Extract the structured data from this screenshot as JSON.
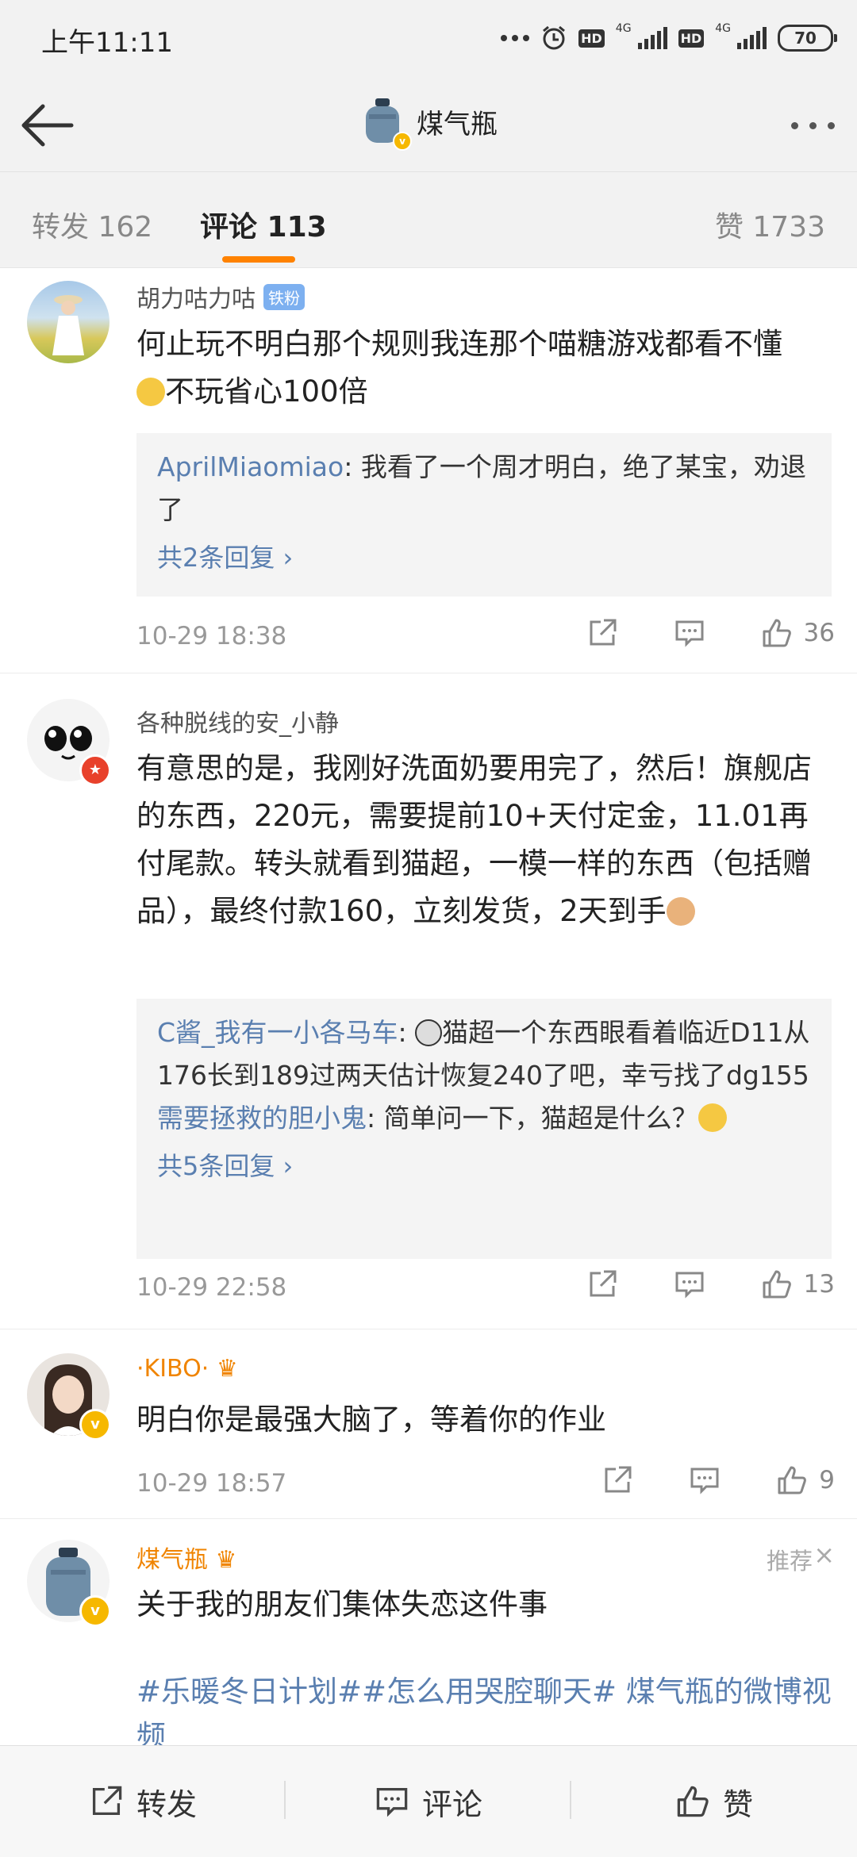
{
  "status": {
    "time": "上午11:11",
    "battery": "70",
    "net": "4G",
    "hd": "HD"
  },
  "nav": {
    "title": "煤气瓶"
  },
  "tabs": {
    "repost": "转发 162",
    "comments": "评论 113",
    "likes": "赞 1733"
  },
  "comments": [
    {
      "name": "胡力咕力咕",
      "badge": "铁粉",
      "text": "何止玩不明白那个规则我连那个喵糖游戏都看不懂",
      "text2": "不玩省心100倍",
      "replies": [
        {
          "name": "AprilMiaomiao",
          "sep": ": ",
          "text": "我看了一个周才明白，绝了某宝，劝退了"
        }
      ],
      "more": "共2条回复 ›",
      "time": "10-29 18:38",
      "likes": "36"
    },
    {
      "name": "各种脱线的安_小静",
      "text": "有意思的是，我刚好洗面奶要用完了，然后！旗舰店的东西，220元，需要提前10+天付定金，11.01再付尾款。转头就看到猫超，一模一样的东西（包括赠品），最终付款160，立刻发货，2天到手",
      "replies": [
        {
          "name": "C酱_我有一小各马车",
          "sep": ": ",
          "text": "猫超一个东西眼看着临近D11从176长到189过两天估计恢复240了吧，幸亏找了dg155"
        },
        {
          "name": "需要拯救的胆小鬼",
          "sep": ": ",
          "text": "简单问一下，猫超是什么？"
        }
      ],
      "more": "共5条回复 ›",
      "time": "10-29 22:58",
      "likes": "13"
    },
    {
      "name": "·KIBO·",
      "text": "明白你是最强大脑了，等着你的作业",
      "time": "10-29 18:57",
      "likes": "9"
    },
    {
      "name": "煤气瓶",
      "text": "关于我的朋友们集体失恋这件事",
      "tags": "#乐暖冬日计划##怎么用哭腔聊天# 煤气瓶的微博视频",
      "recommend": "推荐",
      "close": "×"
    }
  ],
  "bottom": {
    "repost": "转发",
    "comment": "评论",
    "like": "赞"
  },
  "colors": {
    "accent": "#ff8200",
    "link": "#5a7fb0",
    "vip": "#f08400"
  }
}
